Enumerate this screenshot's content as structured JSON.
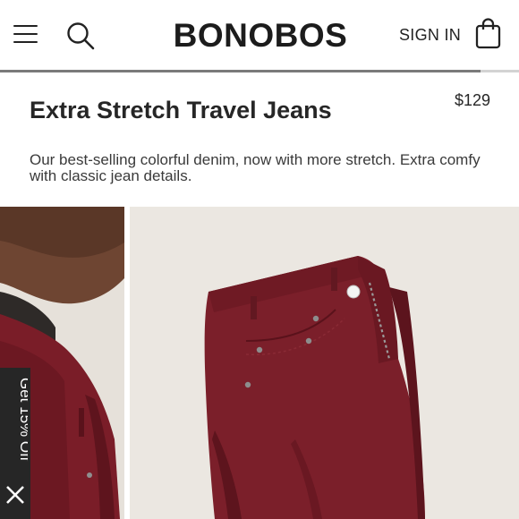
{
  "header": {
    "brand": "BONOBOS",
    "sign_in_label": "SIGN IN",
    "icons": {
      "menu": "hamburger-menu-icon",
      "search": "search-icon",
      "bag": "shopping-bag-icon"
    }
  },
  "progress": {
    "fraction": 0.925
  },
  "product": {
    "title": "Extra Stretch Travel Jeans",
    "price": "$129",
    "description": "Our best-selling colorful denim, now with more stretch. Extra comfy with classic jean details."
  },
  "promo": {
    "label": "Get 15% Off",
    "close_icon": "close-icon"
  },
  "colors": {
    "accent_dark": "#262626",
    "jeans": "#7a1f28",
    "background": "#ffffff"
  }
}
